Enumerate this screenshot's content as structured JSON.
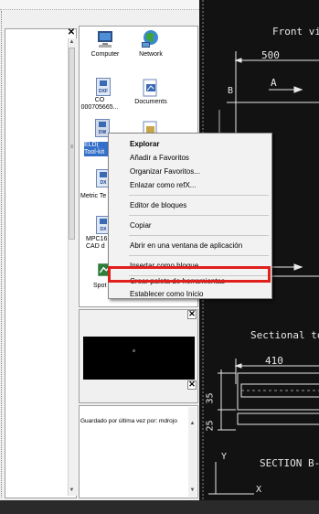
{
  "tree_panel": {
    "close_symbol": "✕",
    "scroll_up_symbol": "▲",
    "scroll_down_symbol": "▼",
    "grip_symbol": "≡"
  },
  "icons": [
    {
      "name": "computer-icon",
      "label": "Computer"
    },
    {
      "name": "network-icon",
      "label": "Network"
    },
    {
      "name": "dxf-file-icon",
      "label": "CO\n000705665..."
    },
    {
      "name": "documents-icon",
      "label": "Documents"
    },
    {
      "name": "eld-file-icon",
      "label": "ELD(\nTool-kit"
    },
    {
      "name": "metric-file-icon",
      "label": "Metric Te"
    },
    {
      "name": "mpc-file-icon",
      "label": "MPC16\nCAD d"
    },
    {
      "name": "spot-file-icon",
      "label": "Spot"
    }
  ],
  "file_badges": {
    "dxf": "DXF",
    "dx": "DX",
    "dw": "DW"
  },
  "context_menu": {
    "items": [
      {
        "label": "Explorar",
        "bold": true
      },
      {
        "label": "Añadir a Favoritos"
      },
      {
        "label": "Organizar Favoritos..."
      },
      {
        "label": "Enlazar como refX..."
      },
      {
        "label": "Editor de bloques"
      },
      {
        "label": "Copiar"
      },
      {
        "label": "Abrir en una ventana de aplicación"
      },
      {
        "label": "Insertar como bloque..."
      },
      {
        "label": "Crear paleta de herramientas",
        "highlighted": true
      },
      {
        "label": "Establecer como Inicio"
      }
    ],
    "highlight_color": "#e0201c"
  },
  "preview_panel": {
    "close_symbol": "✕"
  },
  "description_panel": {
    "close_symbol": "✕",
    "text": "Guardado por última vez por: mdrojo",
    "scroll_up_symbol": "▲",
    "scroll_down_symbol": "▼"
  },
  "cad_drawing": {
    "front_view_label": "Front vie",
    "dim_500": "500",
    "label_A": "A",
    "label_B": "B",
    "sectional_label": "Sectional top",
    "dim_410": "410",
    "dim_35": "35",
    "dim_25": "25",
    "section_label": "SECTION B-",
    "label_Y": "Y",
    "label_X": "X",
    "line_color": "#e8e8e8",
    "background": "#121212"
  }
}
